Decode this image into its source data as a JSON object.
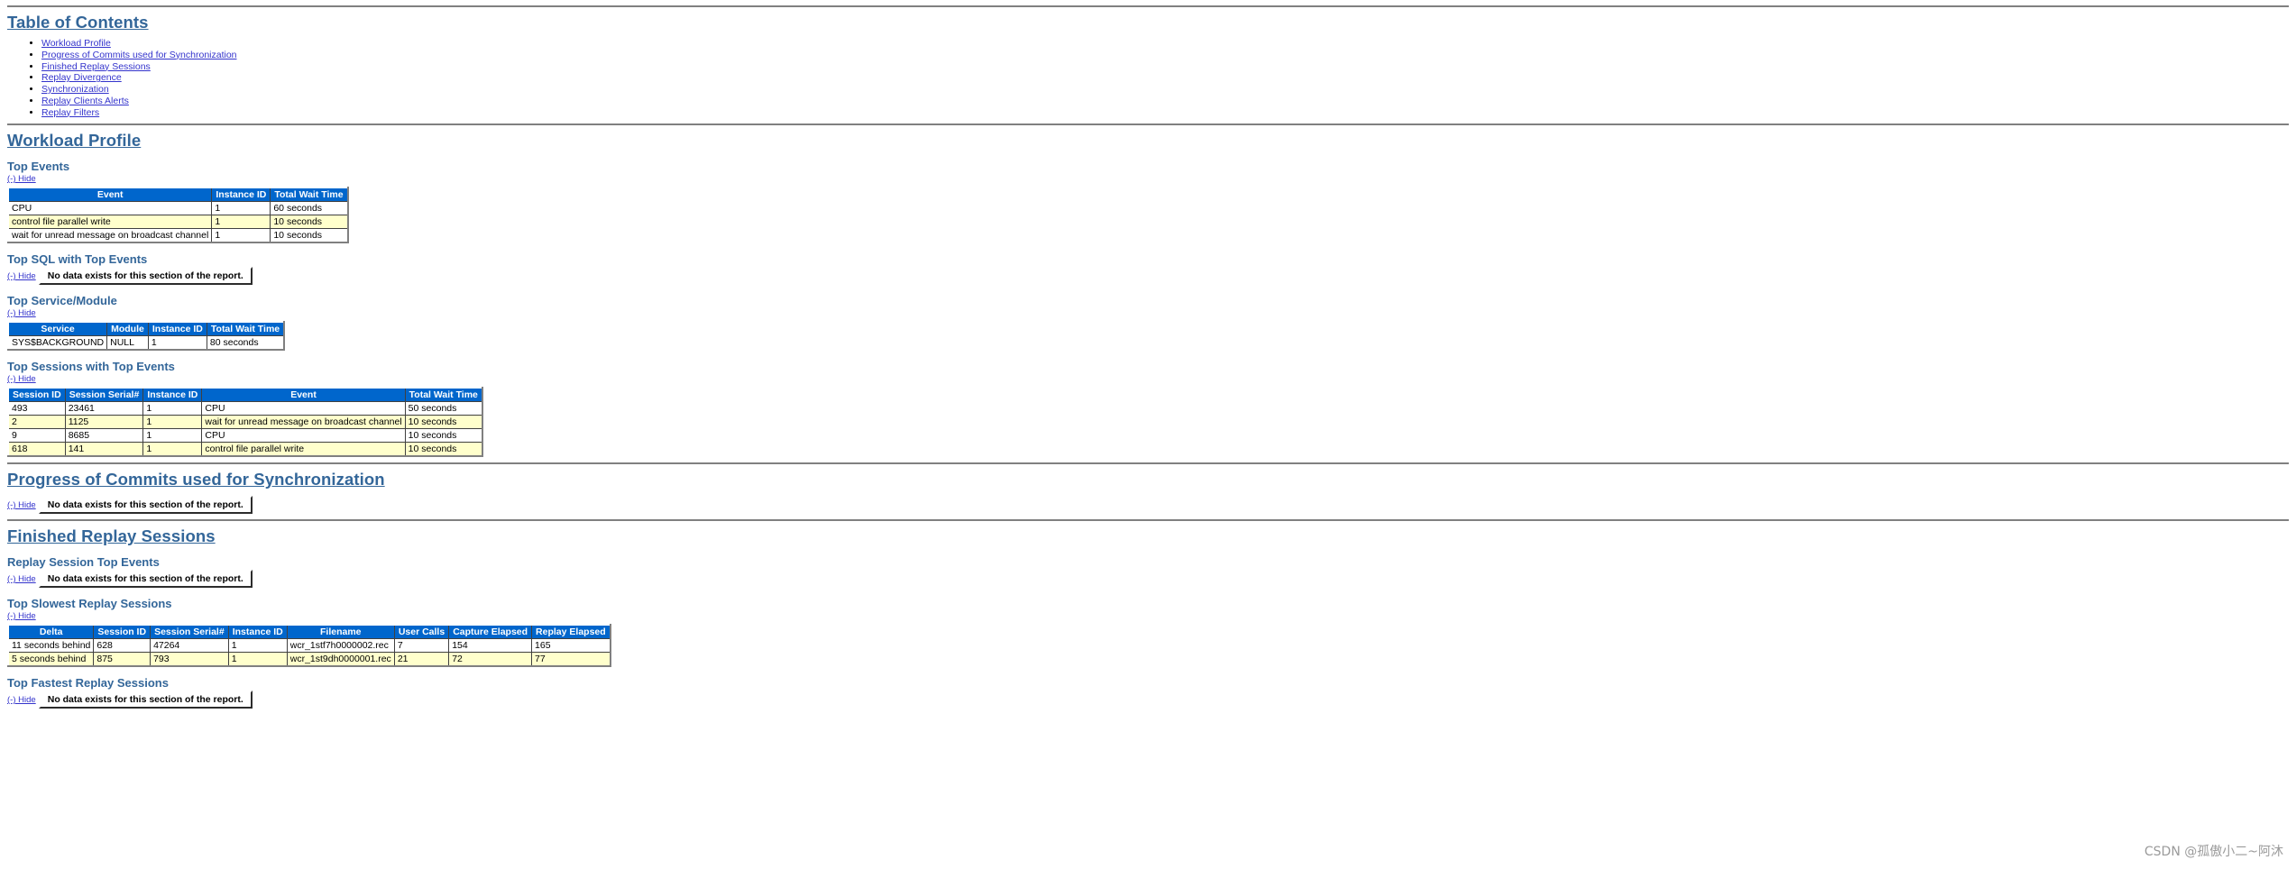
{
  "toc": {
    "heading": "Table of Contents",
    "items": [
      {
        "label": "Workload Profile"
      },
      {
        "label": "Progress of Commits used for Synchronization"
      },
      {
        "label": "Finished Replay Sessions"
      },
      {
        "label": "Replay Divergence"
      },
      {
        "label": "Synchronization"
      },
      {
        "label": "Replay Clients Alerts"
      },
      {
        "label": "Replay Filters"
      }
    ]
  },
  "common": {
    "hide_label": "(-) Hide",
    "no_data_label": "No data exists for this section of the report."
  },
  "sections": {
    "workload_profile": {
      "title": "Workload Profile",
      "top_events": {
        "title": "Top Events",
        "hide": "(-) Hide",
        "columns": [
          "Event",
          "Instance ID",
          "Total Wait Time"
        ],
        "rows": [
          [
            "CPU",
            "1",
            "60 seconds"
          ],
          [
            "control file parallel write",
            "1",
            "10 seconds"
          ],
          [
            "wait for unread message on broadcast channel",
            "1",
            "10 seconds"
          ]
        ]
      },
      "top_sql": {
        "title": "Top SQL with Top Events",
        "hide": "(-) Hide",
        "no_data": "No data exists for this section of the report."
      },
      "top_service_module": {
        "title": "Top Service/Module",
        "hide": "(-) Hide",
        "columns": [
          "Service",
          "Module",
          "Instance ID",
          "Total Wait Time"
        ],
        "rows": [
          [
            "SYS$BACKGROUND",
            "NULL",
            "1",
            "80 seconds"
          ]
        ]
      },
      "top_sessions": {
        "title": "Top Sessions with Top Events",
        "hide": "(-) Hide",
        "columns": [
          "Session ID",
          "Session Serial#",
          "Instance ID",
          "Event",
          "Total Wait Time"
        ],
        "rows": [
          [
            "493",
            "23461",
            "1",
            "CPU",
            "50 seconds"
          ],
          [
            "2",
            "1125",
            "1",
            "wait for unread message on broadcast channel",
            "10 seconds"
          ],
          [
            "9",
            "8685",
            "1",
            "CPU",
            "10 seconds"
          ],
          [
            "618",
            "141",
            "1",
            "control file parallel write",
            "10 seconds"
          ]
        ]
      }
    },
    "progress_commits": {
      "title": "Progress of Commits used for Synchronization",
      "hide": "(-) Hide",
      "no_data": "No data exists for this section of the report."
    },
    "finished_replay_sessions": {
      "title": "Finished Replay Sessions",
      "replay_session_top_events": {
        "title": "Replay Session Top Events",
        "hide": "(-) Hide",
        "no_data": "No data exists for this section of the report."
      },
      "top_slowest": {
        "title": "Top Slowest Replay Sessions",
        "hide": "(-) Hide",
        "columns": [
          "Delta",
          "Session ID",
          "Session Serial#",
          "Instance ID",
          "Filename",
          "User Calls",
          "Capture Elapsed",
          "Replay Elapsed"
        ],
        "rows": [
          [
            "11 seconds behind",
            "628",
            "47264",
            "1",
            "wcr_1stf7h0000002.rec",
            "7",
            "154",
            "165"
          ],
          [
            "5 seconds behind",
            "875",
            "793",
            "1",
            "wcr_1st9dh0000001.rec",
            "21",
            "72",
            "77"
          ]
        ]
      },
      "top_fastest": {
        "title": "Top Fastest Replay Sessions",
        "hide": "(-) Hide",
        "no_data": "No data exists for this section of the report."
      }
    }
  },
  "watermark": "CSDN @孤傲小二~阿沐"
}
